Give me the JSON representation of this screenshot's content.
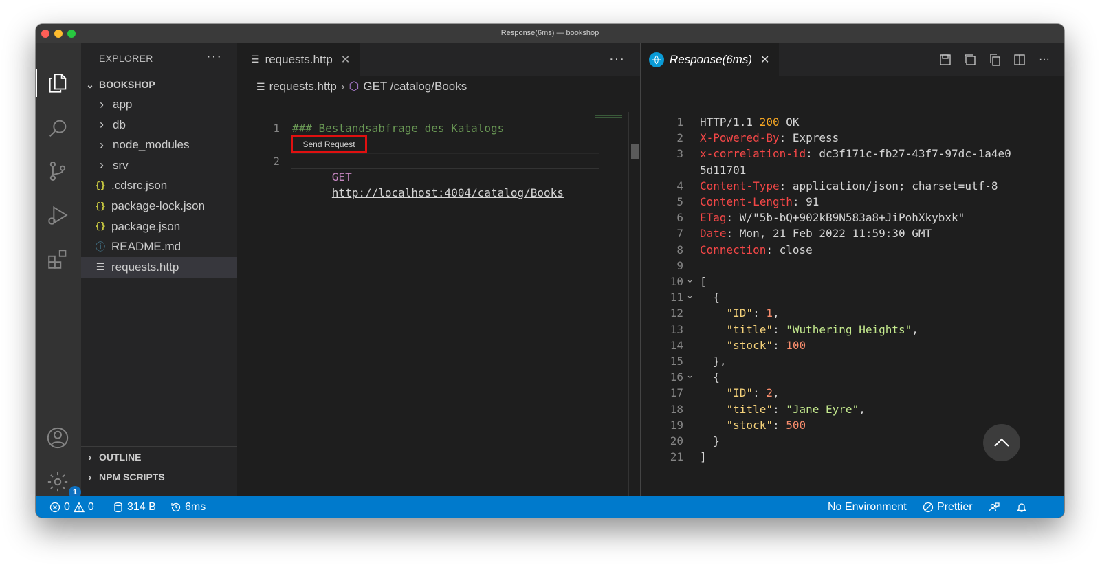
{
  "window": {
    "title": "Response(6ms) — bookshop"
  },
  "activity_bar": {
    "items": [
      "files-icon",
      "search-icon",
      "source-control-icon",
      "run-debug-icon",
      "extensions-icon",
      "account-icon",
      "settings-gear-icon"
    ],
    "settings_badge": "1"
  },
  "explorer": {
    "header": "EXPLORER",
    "more_label": "···",
    "root_folder": "BOOKSHOP",
    "items": [
      {
        "label": "app",
        "type": "folder"
      },
      {
        "label": "db",
        "type": "folder"
      },
      {
        "label": "node_modules",
        "type": "folder"
      },
      {
        "label": "srv",
        "type": "folder"
      },
      {
        "label": ".cdsrc.json",
        "type": "json"
      },
      {
        "label": "package-lock.json",
        "type": "json"
      },
      {
        "label": "package.json",
        "type": "json"
      },
      {
        "label": "README.md",
        "type": "info"
      },
      {
        "label": "requests.http",
        "type": "http",
        "selected": true
      }
    ],
    "json_icon_glyph": "{}",
    "outline_label": "OUTLINE",
    "npm_scripts_label": "NPM SCRIPTS"
  },
  "editor": {
    "tab_label": "requests.http",
    "more_label": "···",
    "breadcrumb": {
      "file": "requests.http",
      "symbol": "GET /catalog/Books"
    },
    "codelens": "Send Request",
    "lines": [
      {
        "num": "1",
        "text": "### Bestandsabfrage des Katalogs"
      },
      {
        "num": "2",
        "method": "GET",
        "url": "http://localhost:4004/catalog/Books"
      }
    ]
  },
  "response": {
    "tab_label": "Response(6ms)",
    "toolbar_icons": [
      "save-icon",
      "save-body-icon",
      "copy-icon",
      "split-editor-icon",
      "more-icon"
    ],
    "more_label": "···",
    "lines": [
      {
        "num": "1",
        "text": "HTTP/1.1 ",
        "status": "200",
        "after": " OK"
      },
      {
        "num": "2",
        "key": "X-Powered-By",
        "value": "Express"
      },
      {
        "num": "3",
        "key": "x-correlation-id",
        "value": "dc3f171c-fb27-43f7-97dc-1a4e0"
      },
      {
        "num": "",
        "cont": "5d11701"
      },
      {
        "num": "4",
        "key": "Content-Type",
        "value": "application/json; charset=utf-8"
      },
      {
        "num": "5",
        "key": "Content-Length",
        "value": "91"
      },
      {
        "num": "6",
        "key": "ETag",
        "value": "W/\"5b-bQ+902kB9N583a8+JiPohXkybxk\""
      },
      {
        "num": "7",
        "key": "Date",
        "value": "Mon, 21 Feb 2022 11:59:30 GMT"
      },
      {
        "num": "8",
        "key": "Connection",
        "value": "close"
      },
      {
        "num": "9"
      },
      {
        "num": "10",
        "punct": "["
      },
      {
        "num": "11",
        "punct": "  {"
      },
      {
        "num": "12",
        "jkey": "\"ID\"",
        "jnum": "1",
        "tail": ","
      },
      {
        "num": "13",
        "jkey": "\"title\"",
        "jstr": "\"Wuthering Heights\"",
        "tail": ","
      },
      {
        "num": "14",
        "jkey": "\"stock\"",
        "jnum": "100"
      },
      {
        "num": "15",
        "punct": "  },"
      },
      {
        "num": "16",
        "punct": "  {"
      },
      {
        "num": "17",
        "jkey": "\"ID\"",
        "jnum": "2",
        "tail": ","
      },
      {
        "num": "18",
        "jkey": "\"title\"",
        "jstr": "\"Jane Eyre\"",
        "tail": ","
      },
      {
        "num": "19",
        "jkey": "\"stock\"",
        "jnum": "500"
      },
      {
        "num": "20",
        "punct": "  }"
      },
      {
        "num": "21",
        "punct": "]"
      }
    ]
  },
  "status_bar": {
    "errors": "0",
    "warnings": "0",
    "size": "314 B",
    "time": "6ms",
    "environment": "No Environment",
    "prettier": "Prettier"
  },
  "colors": {
    "accent": "#007acc",
    "highlight_box": "#e01010"
  }
}
